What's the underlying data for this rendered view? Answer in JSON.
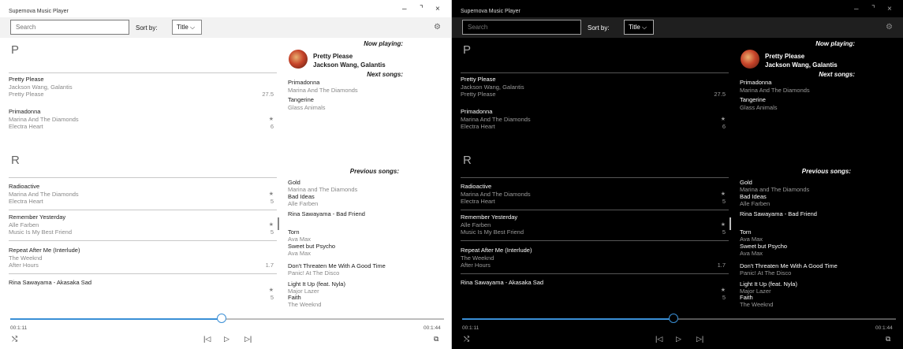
{
  "app": {
    "title": "Supernova Music Player"
  },
  "window_controls": {
    "minimize": "–",
    "maximize": "⌝",
    "close": "×"
  },
  "toolbar": {
    "search_placeholder": "Search",
    "sort_label": "Sort by:",
    "sort_value": "Title ⌵"
  },
  "icons": {
    "settings": "gear-icon",
    "shuffle": "shuffle-icon",
    "prev": "previous-icon",
    "play": "play-icon",
    "next": "next-icon",
    "miniplayer": "miniplayer-icon"
  },
  "groups": [
    {
      "letter": "P",
      "songs": [
        {
          "title": "Pretty Please",
          "artist": "Jackson Wang, Galantis",
          "album": "Pretty Please",
          "score": "27.5",
          "star": ""
        },
        {
          "title": "Primadonna",
          "artist": "Marina And The Diamonds",
          "album": "Electra Heart",
          "score": "6",
          "star": "★"
        }
      ]
    },
    {
      "letter": "R",
      "songs": [
        {
          "title": "Radioactive",
          "artist": "Marina And The Diamonds",
          "album": "Electra Heart",
          "score": "5",
          "star": "★"
        },
        {
          "title": "Remember Yesterday",
          "artist": "Alle Farben",
          "album": "Music Is My Best Friend",
          "score": "5",
          "star": "★"
        },
        {
          "title": "Repeat After Me (Interlude)",
          "artist": "The Weeknd",
          "album": "After Hours",
          "score": "1.7",
          "star": ""
        },
        {
          "title": "Rina Sawayama - Akasaka Sad",
          "artist": "",
          "album": "",
          "score": "5",
          "star": "★"
        }
      ]
    }
  ],
  "now_playing": {
    "heading": "Now playing:",
    "title": "Pretty Please",
    "artist": "Jackson Wang, Galantis"
  },
  "next_songs": {
    "heading": "Next songs:",
    "items": [
      {
        "title": "Primadonna",
        "artist": "Marina And The Diamonds"
      },
      {
        "title": "Tangerine",
        "artist": "Glass Animals"
      }
    ]
  },
  "previous_songs": {
    "heading": "Previous songs:",
    "items": [
      {
        "title": "Gold",
        "artist": "Marina and The Diamonds"
      },
      {
        "title": "Bad Ideas",
        "artist": "Alle Farben"
      },
      {
        "title": "Rina Sawayama - Bad Friend",
        "artist": ""
      },
      {
        "title": "Torn",
        "artist": "Ava Max"
      },
      {
        "title": "Sweet but Psycho",
        "artist": "Ava Max"
      },
      {
        "title": "Don't Threaten Me With A Good Time",
        "artist": "Panic! At The Disco"
      },
      {
        "title": "Light It Up (feat. Nyla)",
        "artist": "Major Lazer"
      },
      {
        "title": "Faith",
        "artist": "The Weeknd"
      }
    ]
  },
  "playback": {
    "elapsed": "00:1:11",
    "total": "00:1:44",
    "progress": 0.487
  },
  "playbar": {
    "shuffle": "⤭",
    "prev": "|◁",
    "play": "▷",
    "next": "▷|",
    "miniplayer": "⧉"
  },
  "colors": {
    "accent": "#3a8fd6",
    "light_bg": "#ffffff",
    "dark_bg": "#000000"
  }
}
